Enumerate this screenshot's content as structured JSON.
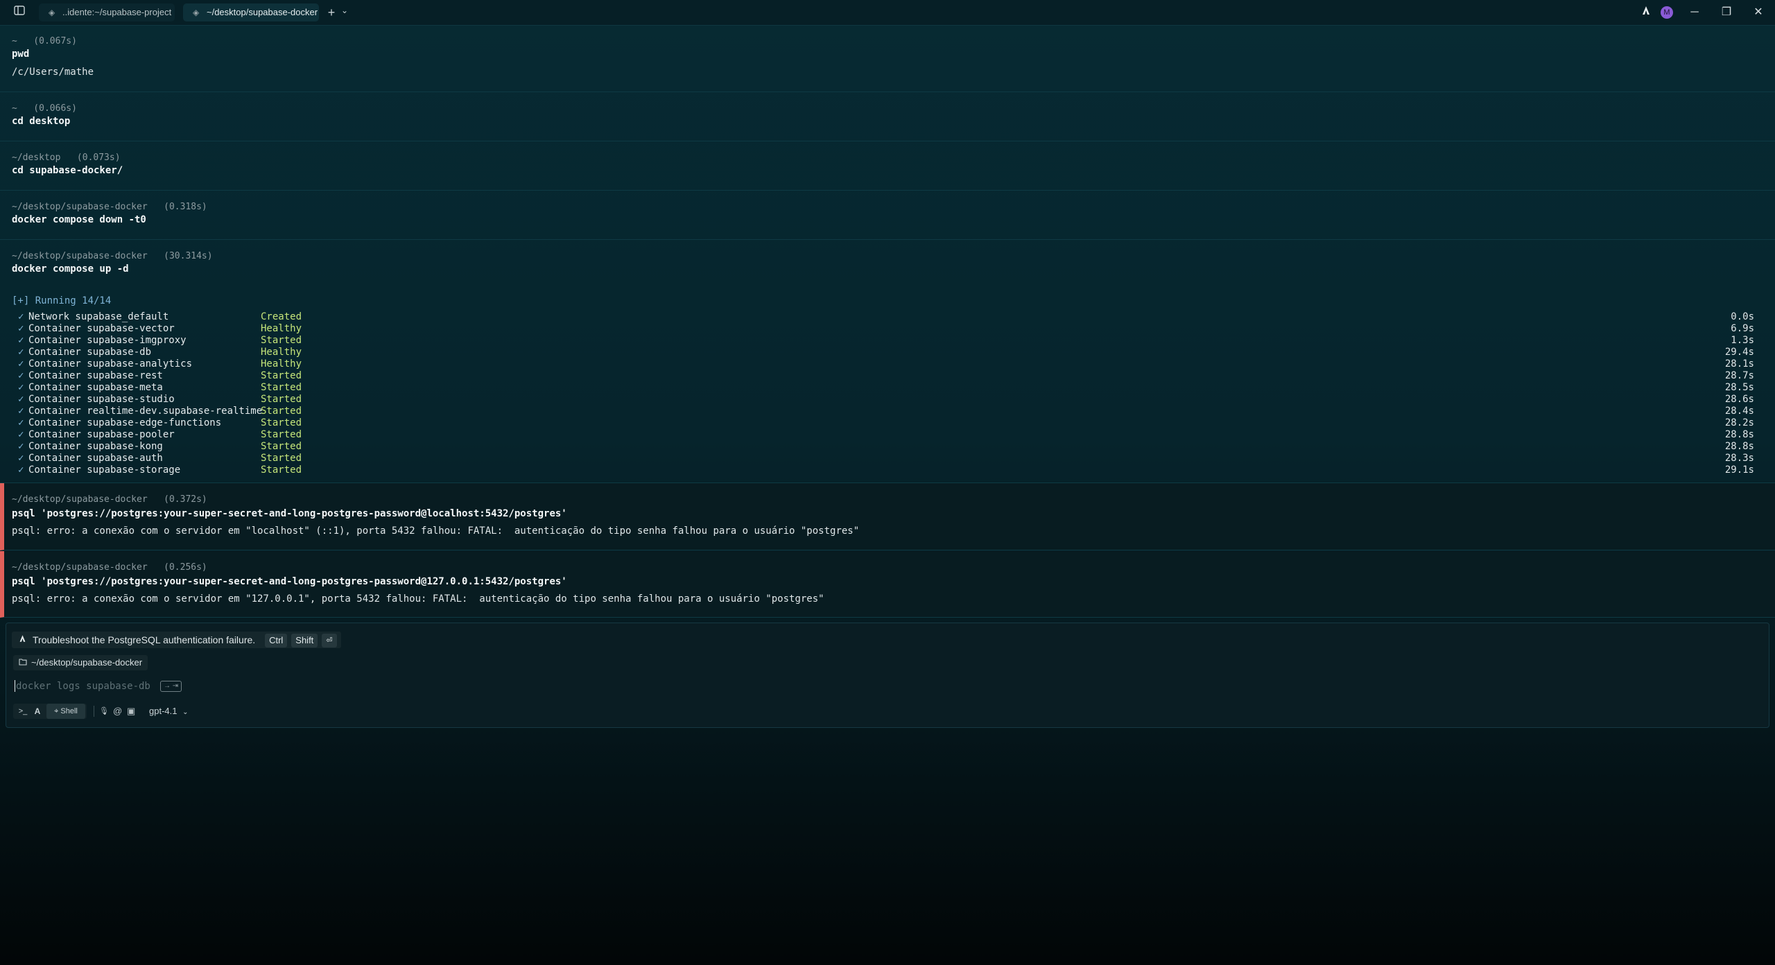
{
  "tabs": [
    {
      "label": "..idente:~/supabase-project",
      "active": false
    },
    {
      "label": "~/desktop/supabase-docker",
      "active": true
    }
  ],
  "titlebar_icons": {
    "sidebar": "sidebar-toggle-icon",
    "add_tab": "+",
    "tab_dropdown": "⌄",
    "agent": "agent-logo-icon",
    "avatar_letter": "M"
  },
  "window_controls": {
    "minimize": "─",
    "maximize": "❐",
    "close": "✕"
  },
  "blocks": [
    {
      "prompt": "~   (0.067s)",
      "command": "pwd",
      "output": [
        "/c/Users/mathe"
      ]
    },
    {
      "prompt": "~   (0.066s)",
      "command": "cd desktop",
      "output": []
    },
    {
      "prompt": "~/desktop   (0.073s)",
      "command": "cd supabase-docker/",
      "output": []
    },
    {
      "prompt": "~/desktop/supabase-docker   (0.318s)",
      "command": "docker compose down -t0",
      "output": []
    },
    {
      "prompt": "~/desktop/supabase-docker   (30.314s)",
      "command": "docker compose up -d",
      "output": []
    }
  ],
  "compose": {
    "running": "[+] Running 14/14",
    "rows": [
      {
        "name": "Network supabase_default",
        "status": "Created",
        "time": "0.0s"
      },
      {
        "name": "Container supabase-vector",
        "status": "Healthy",
        "time": "6.9s"
      },
      {
        "name": "Container supabase-imgproxy",
        "status": "Started",
        "time": "1.3s"
      },
      {
        "name": "Container supabase-db",
        "status": "Healthy",
        "time": "29.4s"
      },
      {
        "name": "Container supabase-analytics",
        "status": "Healthy",
        "time": "28.1s"
      },
      {
        "name": "Container supabase-rest",
        "status": "Started",
        "time": "28.7s"
      },
      {
        "name": "Container supabase-meta",
        "status": "Started",
        "time": "28.5s"
      },
      {
        "name": "Container supabase-studio",
        "status": "Started",
        "time": "28.6s"
      },
      {
        "name": "Container realtime-dev.supabase-realtime",
        "status": "Started",
        "time": "28.4s"
      },
      {
        "name": "Container supabase-edge-functions",
        "status": "Started",
        "time": "28.2s"
      },
      {
        "name": "Container supabase-pooler",
        "status": "Started",
        "time": "28.8s"
      },
      {
        "name": "Container supabase-kong",
        "status": "Started",
        "time": "28.8s"
      },
      {
        "name": "Container supabase-auth",
        "status": "Started",
        "time": "28.3s"
      },
      {
        "name": "Container supabase-storage",
        "status": "Started",
        "time": "29.1s"
      }
    ]
  },
  "error_blocks": [
    {
      "prompt": "~/desktop/supabase-docker   (0.372s)",
      "command": "psql 'postgres://postgres:your-super-secret-and-long-postgres-password@localhost:5432/postgres'",
      "output": "psql: erro: a conexão com o servidor em \"localhost\" (::1), porta 5432 falhou: FATAL:  autenticação do tipo senha falhou para o usuário \"postgres\""
    },
    {
      "prompt": "~/desktop/supabase-docker   (0.256s)",
      "command": "psql 'postgres://postgres:your-super-secret-and-long-postgres-password@127.0.0.1:5432/postgres'",
      "output": "psql: erro: a conexão com o servidor em \"127.0.0.1\", porta 5432 falhou: FATAL:  autenticação do tipo senha falhou para o usuário \"postgres\""
    }
  ],
  "input_panel": {
    "suggestion": "Troubleshoot the PostgreSQL authentication failure.",
    "keys": [
      "Ctrl",
      "Shift",
      "⏎"
    ],
    "directory": "~/desktop/supabase-docker",
    "placeholder": "docker logs supabase-db",
    "hint_chip": "→ ⇥",
    "mode_terminal": ">_",
    "mode_agent": "A",
    "mode_shell": "Shell",
    "tools": {
      "mic": "🎙",
      "at": "@",
      "image": "▣"
    },
    "model": "gpt-4.1"
  },
  "colors": {
    "accent_blue": "#7fb4d6",
    "status_green": "#c6e67a",
    "error_red": "#e0605a",
    "avatar": "#8a5bd6"
  }
}
